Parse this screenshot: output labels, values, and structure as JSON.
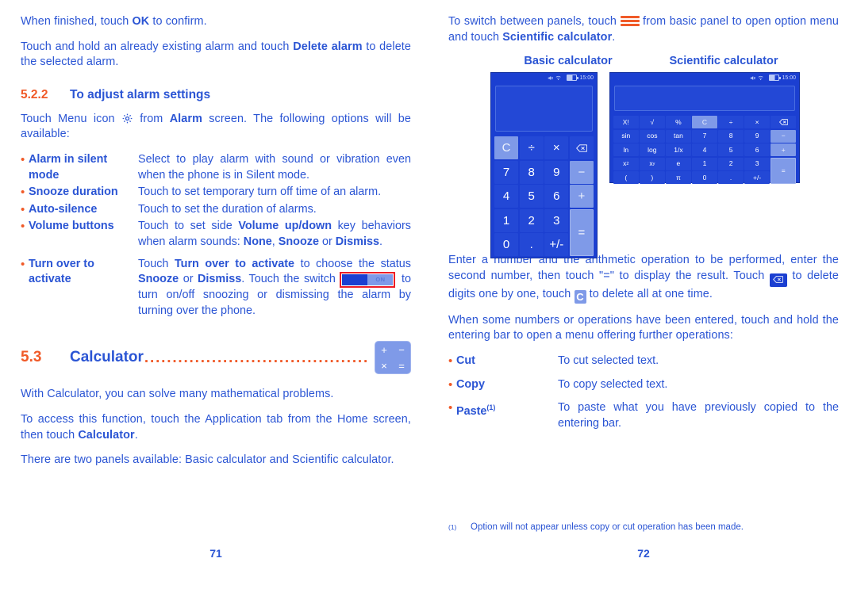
{
  "left": {
    "para_ok": "When finished, touch OK to confirm.",
    "para_ok_parts": {
      "a": "When finished, touch ",
      "b": "OK",
      "c": " to confirm."
    },
    "para_delete_parts": {
      "a": "Touch and hold an already existing alarm and touch ",
      "b": "Delete alarm",
      "c": " to delete the selected alarm."
    },
    "section": {
      "number": "5.2.2",
      "title": "To adjust alarm settings"
    },
    "para_menu_parts": {
      "a": "Touch Menu icon ",
      "icon": "gear-icon",
      "b": " from ",
      "c": "Alarm",
      "d": " screen. The following options will be available:"
    },
    "options": [
      {
        "term": "Alarm in silent mode",
        "desc": "Select to play alarm with sound or vibration even when the phone is in Silent mode."
      },
      {
        "term": "Snooze duration",
        "desc": "Touch to set temporary turn off time of an alarm."
      },
      {
        "term": "Auto-silence",
        "desc": "Touch to set the duration of alarms."
      },
      {
        "term": "Volume buttons",
        "desc_parts": {
          "a": "Touch to set side ",
          "b": "Volume up/down",
          "c": " key behaviors when alarm sounds: ",
          "d": "None",
          "e": ", ",
          "f": "Snooze",
          "g": " or ",
          "h": "Dismiss",
          "i": "."
        }
      },
      {
        "term": "Turn over to activate",
        "desc_parts": {
          "a": "Touch ",
          "b": "Turn over to activate",
          "c": " to choose the status ",
          "d": "Snooze",
          "e": " or ",
          "f": "Dismiss",
          "g": ". Touch the switch ",
          "switch_label": "ON",
          "h": " to turn on/off snoozing or dismissing the alarm by turning over the phone."
        }
      }
    ],
    "chapter": {
      "number": "5.3",
      "title": "Calculator",
      "leader": "..................................................",
      "icon_keys": [
        "+",
        "−",
        "×",
        "="
      ]
    },
    "para_with_parts": {
      "a": "With Calculator, you can solve many mathematical problems."
    },
    "para_access_parts": {
      "a": "To access this function, touch the Application tab from the Home screen, then touch ",
      "b": "Calculator",
      "c": "."
    },
    "para_panels": "There are two panels available: Basic calculator and Scientific calculator.",
    "page_number": "71"
  },
  "right": {
    "para_switch_parts": {
      "a": "To switch between panels, touch ",
      "icon": "menu-icon",
      "b": " from basic panel to open option menu and touch ",
      "c": "Scientific calculator",
      "d": "."
    },
    "shots": {
      "basic_title": "Basic calculator",
      "sci_title": "Scientific calculator",
      "status_time": "15:00",
      "basic_keys": [
        {
          "label": "C",
          "style": "hl"
        },
        {
          "label": "÷",
          "style": ""
        },
        {
          "label": "×",
          "style": ""
        },
        {
          "label": "backspace-icon",
          "style": "icon"
        },
        {
          "label": "7",
          "style": ""
        },
        {
          "label": "8",
          "style": ""
        },
        {
          "label": "9",
          "style": ""
        },
        {
          "label": "−",
          "style": "hl"
        },
        {
          "label": "4",
          "style": ""
        },
        {
          "label": "5",
          "style": ""
        },
        {
          "label": "6",
          "style": ""
        },
        {
          "label": "+",
          "style": "hl"
        },
        {
          "label": "1",
          "style": ""
        },
        {
          "label": "2",
          "style": ""
        },
        {
          "label": "3",
          "style": ""
        },
        {
          "label": "=",
          "style": "eq"
        },
        {
          "label": "0",
          "style": ""
        },
        {
          "label": ".",
          "style": ""
        },
        {
          "label": "+/-",
          "style": ""
        }
      ],
      "sci_keys": [
        {
          "label": "X!",
          "style": ""
        },
        {
          "label": "√",
          "style": ""
        },
        {
          "label": "%",
          "style": ""
        },
        {
          "label": "C",
          "style": "hl"
        },
        {
          "label": "÷",
          "style": ""
        },
        {
          "label": "×",
          "style": ""
        },
        {
          "label": "backspace-icon",
          "style": "icon"
        },
        {
          "label": "sin",
          "style": ""
        },
        {
          "label": "cos",
          "style": ""
        },
        {
          "label": "tan",
          "style": ""
        },
        {
          "label": "7",
          "style": ""
        },
        {
          "label": "8",
          "style": ""
        },
        {
          "label": "9",
          "style": ""
        },
        {
          "label": "−",
          "style": "hl"
        },
        {
          "label": "ln",
          "style": ""
        },
        {
          "label": "log",
          "style": ""
        },
        {
          "label": "1/x",
          "style": ""
        },
        {
          "label": "4",
          "style": ""
        },
        {
          "label": "5",
          "style": ""
        },
        {
          "label": "6",
          "style": ""
        },
        {
          "label": "+",
          "style": "hl"
        },
        {
          "label": "x2",
          "style": "sup2"
        },
        {
          "label": "xy",
          "style": "supy"
        },
        {
          "label": "e",
          "style": ""
        },
        {
          "label": "1",
          "style": ""
        },
        {
          "label": "2",
          "style": ""
        },
        {
          "label": "3",
          "style": ""
        },
        {
          "label": "=",
          "style": "eq"
        },
        {
          "label": "(",
          "style": ""
        },
        {
          "label": ")",
          "style": ""
        },
        {
          "label": "π",
          "style": ""
        },
        {
          "label": "0",
          "style": ""
        },
        {
          "label": ".",
          "style": ""
        },
        {
          "label": "+/-",
          "style": ""
        }
      ]
    },
    "para_enter_parts": {
      "a": "Enter a number and the arithmetic operation to be performed, enter the second number, then touch \"=\" to display the result. Touch ",
      "icon1": "backspace-icon",
      "b": " to delete digits one by one, touch ",
      "icon2": "clear-key-icon",
      "c": " to delete all at one time."
    },
    "para_hold": "When some numbers or operations have been entered, touch and hold the entering bar to open a menu offering further operations:",
    "options": [
      {
        "term": "Cut",
        "desc": "To cut selected text."
      },
      {
        "term": "Copy",
        "desc": "To copy selected text."
      },
      {
        "term": "Paste",
        "sup": "(1)",
        "desc": "To paste what you have previously copied to the entering bar."
      }
    ],
    "footnote": {
      "mark": "(1)",
      "text": "Option will not appear unless copy or cut operation has been made."
    },
    "page_number": "72"
  },
  "colors": {
    "text_blue": "#2b55d4",
    "accent_orange": "#f05a28",
    "highlight_red": "#ee1c25",
    "screen_blue": "#1b3fd1",
    "key_blue": "#2348d6",
    "key_light": "#7f9ae8"
  }
}
